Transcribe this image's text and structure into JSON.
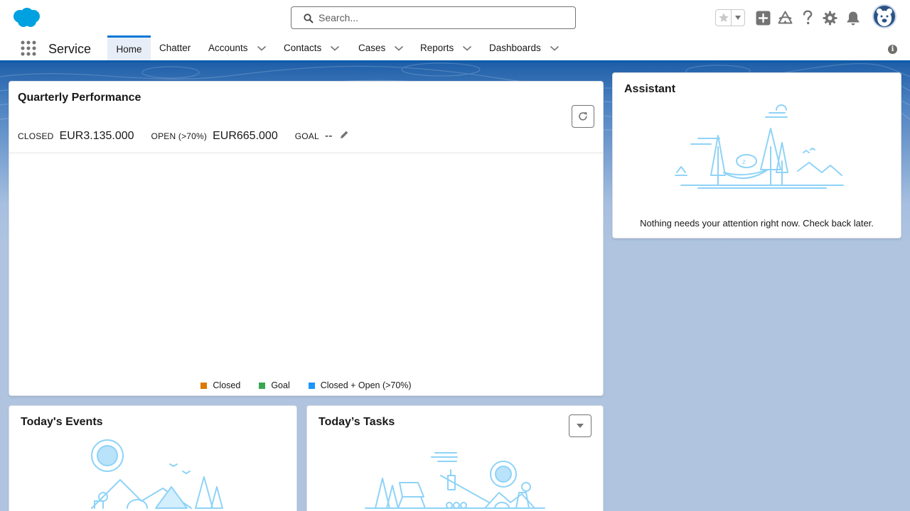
{
  "header": {
    "search": {
      "placeholder": "Search..."
    },
    "icons": [
      "favorites-star-icon",
      "add-icon",
      "trailhead-icon",
      "help-icon",
      "setup-gear-icon",
      "notifications-bell-icon",
      "avatar"
    ]
  },
  "nav": {
    "app_name": "Service",
    "items": [
      {
        "label": "Home",
        "active": true,
        "has_menu": false
      },
      {
        "label": "Chatter",
        "active": false,
        "has_menu": false
      },
      {
        "label": "Accounts",
        "active": false,
        "has_menu": true
      },
      {
        "label": "Contacts",
        "active": false,
        "has_menu": true
      },
      {
        "label": "Cases",
        "active": false,
        "has_menu": true
      },
      {
        "label": "Reports",
        "active": false,
        "has_menu": true
      },
      {
        "label": "Dashboards",
        "active": false,
        "has_menu": true
      }
    ]
  },
  "quarterly_performance": {
    "title": "Quarterly Performance",
    "closed_label": "CLOSED",
    "closed_value": "EUR3.135.000",
    "open_label": "OPEN (>70%)",
    "open_value": "EUR665.000",
    "goal_label": "GOAL",
    "goal_value": "--",
    "legend": [
      {
        "label": "Closed",
        "color": "#dd7a01"
      },
      {
        "label": "Goal",
        "color": "#3ba755"
      },
      {
        "label": "Closed + Open (>70%)",
        "color": "#1b96ff"
      }
    ]
  },
  "assistant": {
    "title": "Assistant",
    "message": "Nothing needs your attention right now. Check back later."
  },
  "events": {
    "title": "Today's Events"
  },
  "tasks": {
    "title": "Today’s Tasks"
  },
  "colors": {
    "brand": "#0176d3",
    "nav_border": "#0b5cab",
    "illustration": "#8fd3f7"
  }
}
